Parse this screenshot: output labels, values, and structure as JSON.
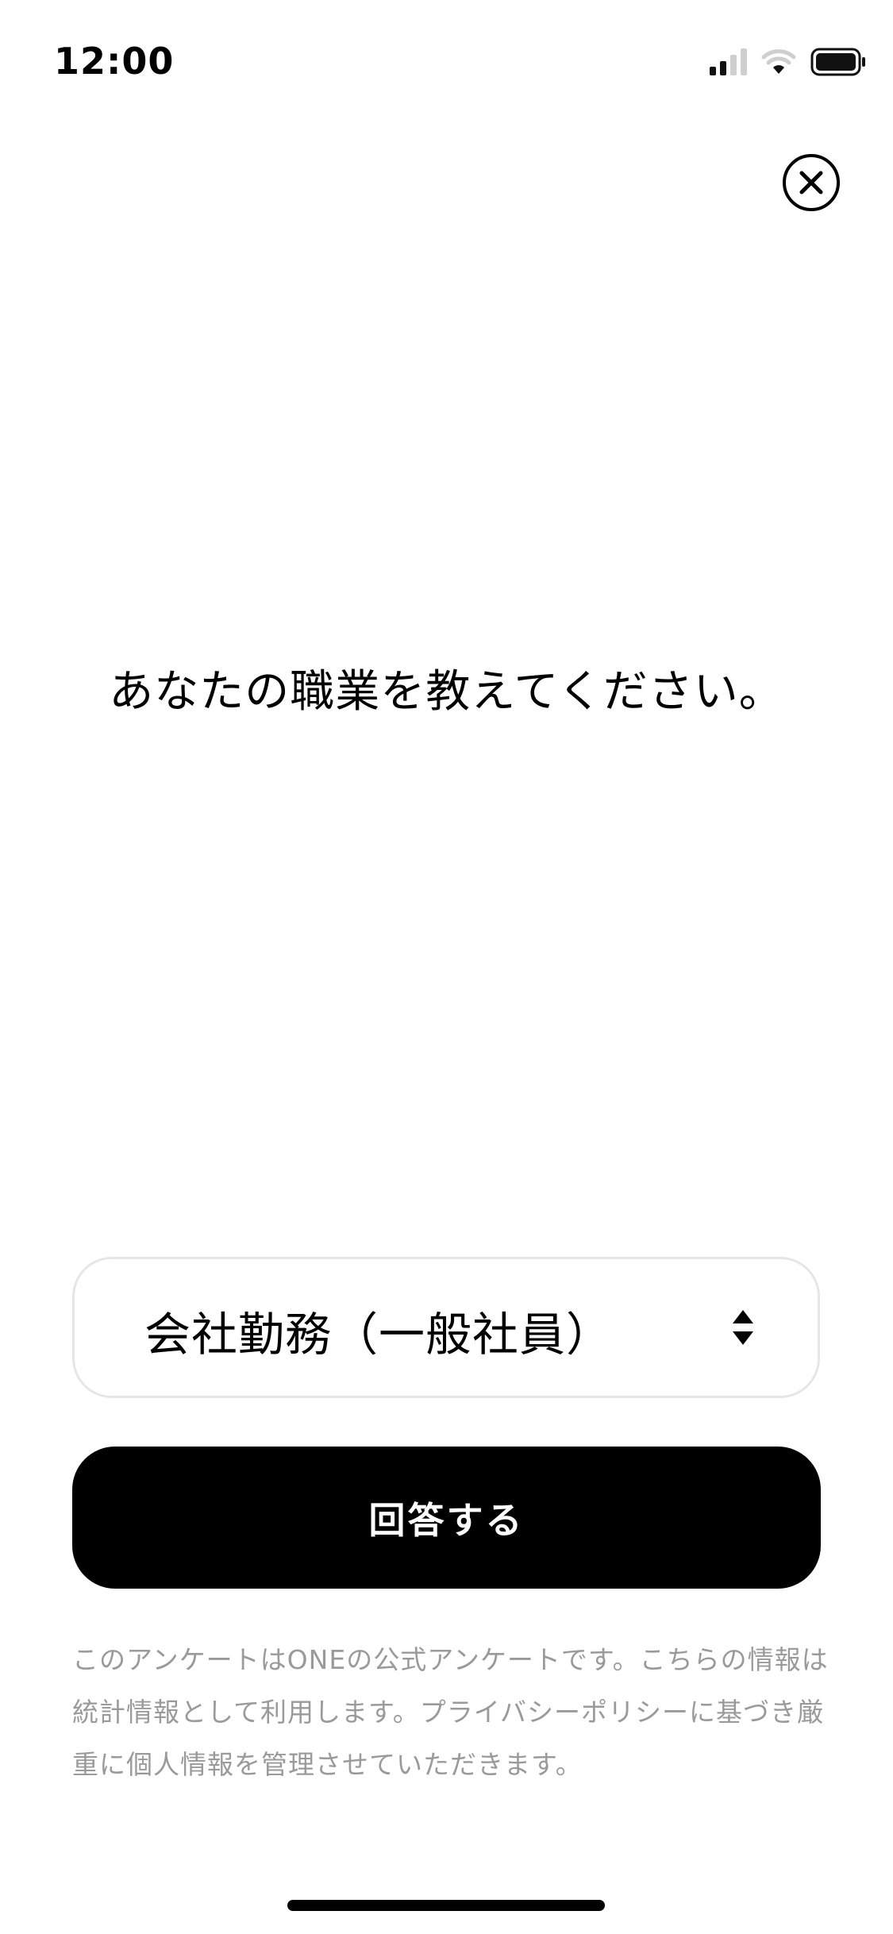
{
  "status_bar": {
    "time": "12:00",
    "icons": [
      "cellular-signal-icon",
      "wifi-icon",
      "battery-icon"
    ]
  },
  "close_icon": "close-circle-icon",
  "question": "あなたの職業を教えてください。",
  "select": {
    "value": "会社勤務（一般社員）",
    "icon": "sort-arrows-icon"
  },
  "submit_label": "回答する",
  "disclaimer": "このアンケートはONEの公式アンケートです。こちらの情報は統計情報として利用します。プライバシーポリシーに基づき厳重に個人情報を管理させていただきます。",
  "colors": {
    "background": "#ffffff",
    "primary_button": "#000000",
    "disclaimer_text": "#9a9a9a",
    "select_border": "#e6e6e6"
  }
}
